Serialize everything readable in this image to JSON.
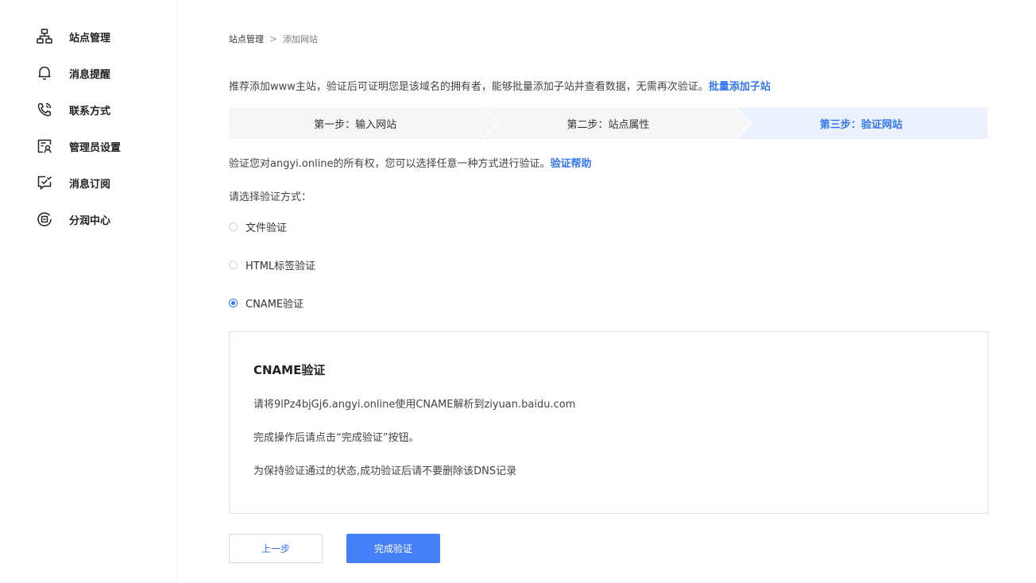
{
  "sidebar": {
    "items": [
      {
        "label": "站点管理",
        "icon": "sitemap-icon"
      },
      {
        "label": "消息提醒",
        "icon": "bell-icon"
      },
      {
        "label": "联系方式",
        "icon": "phone-icon"
      },
      {
        "label": "管理员设置",
        "icon": "admin-user-icon"
      },
      {
        "label": "消息订阅",
        "icon": "message-check-icon"
      },
      {
        "label": "分润中心",
        "icon": "revenue-share-icon"
      }
    ]
  },
  "breadcrumb": {
    "root": "站点管理",
    "separator": ">",
    "current": "添加网站"
  },
  "tip": {
    "text": "推荐添加www主站，验证后可证明您是该域名的拥有者，能够批量添加子站并查看数据，无需再次验证。",
    "link": "批量添加子站"
  },
  "steps": [
    {
      "label": "第一步：输入网站",
      "active": false
    },
    {
      "label": "第二步：站点属性",
      "active": false
    },
    {
      "label": "第三步：验证网站",
      "active": true
    }
  ],
  "verify": {
    "intro": "验证您对angyi.online的所有权，您可以选择任意一种方式进行验证。",
    "help_link": "验证帮助",
    "choose_label": "请选择验证方式：",
    "options": [
      {
        "label": "文件验证",
        "checked": false
      },
      {
        "label": "HTML标签验证",
        "checked": false
      },
      {
        "label": "CNAME验证",
        "checked": true
      }
    ]
  },
  "cname_box": {
    "title": "CNAME验证",
    "lines": [
      "请将9lPz4bjGj6.angyi.online使用CNAME解析到ziyuan.baidu.com",
      "完成操作后请点击“完成验证”按钮。",
      "为保持验证通过的状态,成功验证后请不要删除该DNS记录"
    ]
  },
  "buttons": {
    "prev": "上一步",
    "done": "完成验证"
  },
  "colors": {
    "accent": "#3377ee",
    "primary_button": "#4680f7",
    "active_step_bg": "#ebf1fd",
    "step_bg": "#f6f6f6"
  }
}
